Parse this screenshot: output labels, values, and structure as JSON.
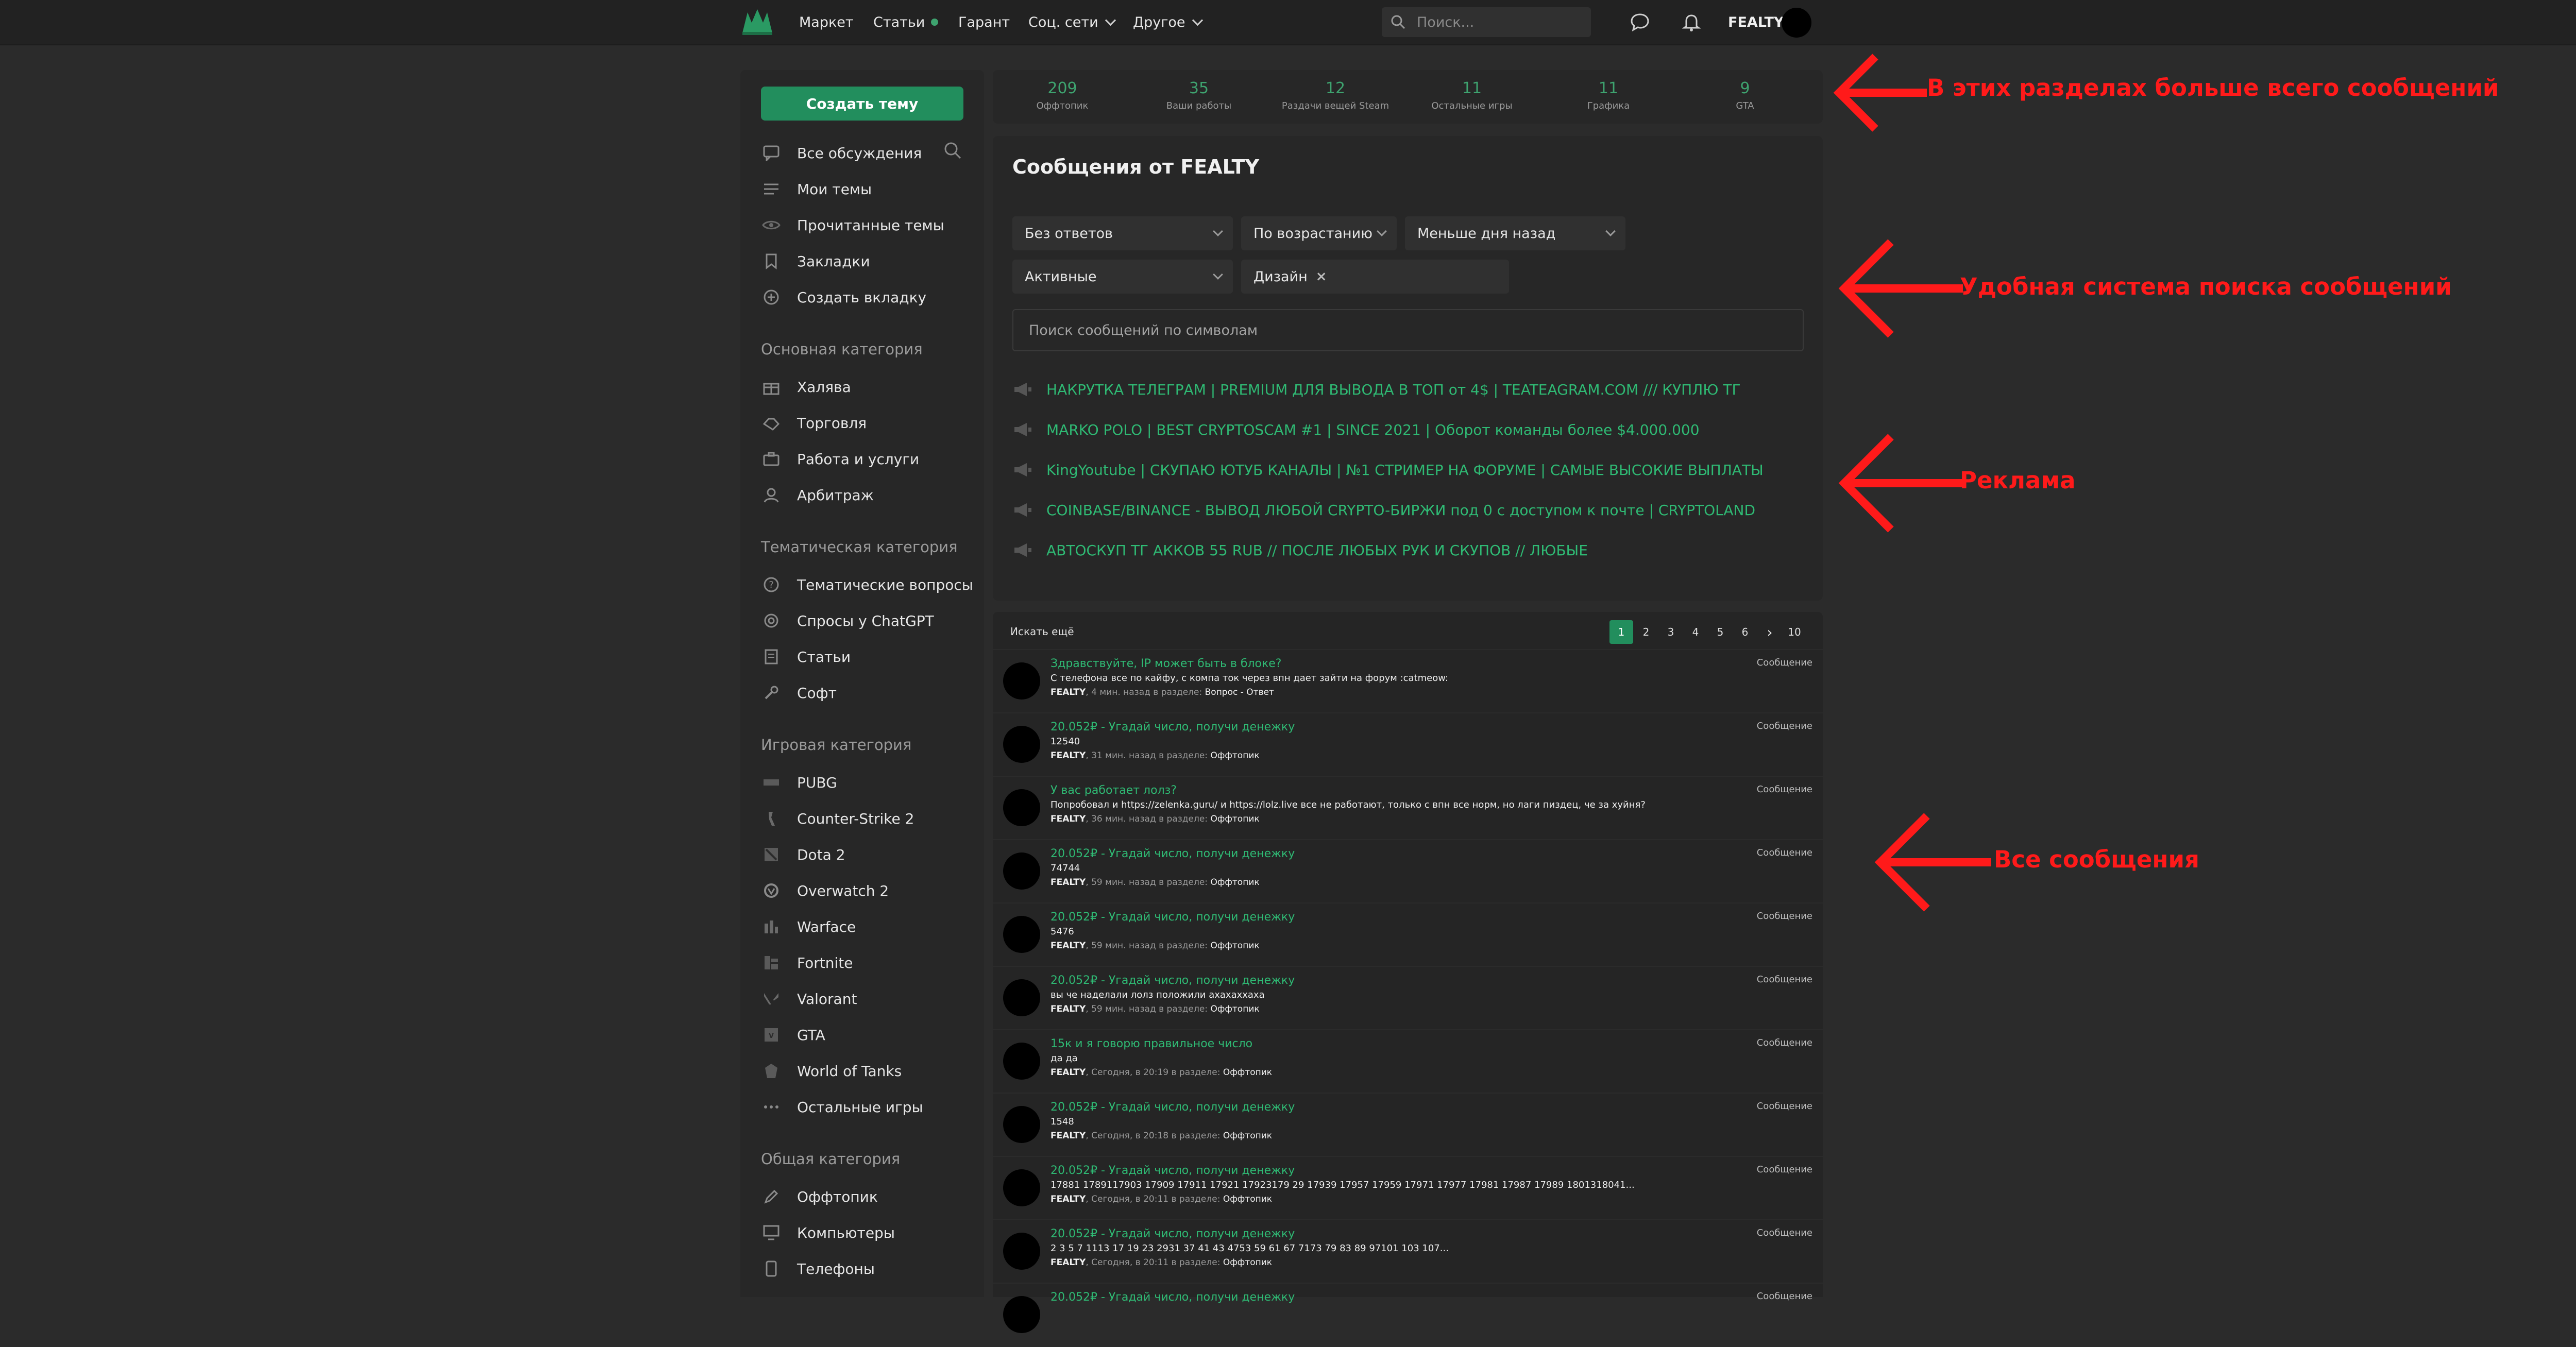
{
  "colors": {
    "accent": "#2fba74",
    "button": "#228e5d",
    "annotation": "#ff1a1a"
  },
  "topbar": {
    "logo_icon": "tree-logo-icon",
    "nav": [
      "Маркет",
      "Статьи",
      "Гарант",
      "Соц. сети",
      "Другое"
    ],
    "search_placeholder": "Поиск...",
    "username": "FEALTY",
    "icons": [
      "chat-icon",
      "bell-icon"
    ]
  },
  "sidebar": {
    "create_button": "Создать тему",
    "main_items": [
      {
        "label": "Все обсуждения",
        "icon": "discussions-icon"
      },
      {
        "label": "Мои темы",
        "icon": "list-icon"
      },
      {
        "label": "Прочитанные темы",
        "icon": "eye-icon"
      },
      {
        "label": "Закладки",
        "icon": "bookmark-icon"
      },
      {
        "label": "Создать вкладку",
        "icon": "plus-circle-icon"
      }
    ],
    "categories": [
      {
        "title": "Основная категория",
        "items": [
          "Халява",
          "Торговля",
          "Работа и услуги",
          "Арбитраж"
        ]
      },
      {
        "title": "Тематическая категория",
        "items": [
          "Тематические вопросы",
          "Спросы у ChatGPT",
          "Статьи",
          "Софт"
        ]
      },
      {
        "title": "Игровая категория",
        "items": [
          "PUBG",
          "Counter-Strike 2",
          "Dota 2",
          "Overwatch 2",
          "Warface",
          "Fortnite",
          "Valorant",
          "GTA",
          "World of Tanks",
          "Остальные игры"
        ]
      },
      {
        "title": "Общая категория",
        "items": [
          "Оффтопик",
          "Компьютеры",
          "Телефоны"
        ]
      }
    ]
  },
  "stats": [
    {
      "value": "209",
      "label": "Оффтопик"
    },
    {
      "value": "35",
      "label": "Ваши работы"
    },
    {
      "value": "12",
      "label": "Раздачи вещей Steam"
    },
    {
      "value": "11",
      "label": "Остальные игры"
    },
    {
      "value": "11",
      "label": "Графика"
    },
    {
      "value": "9",
      "label": "GTA"
    }
  ],
  "panel": {
    "title": "Сообщения от FEALTY",
    "filters": {
      "replies": "Без ответов",
      "order": "По возрастанию",
      "period": "Меньше дня назад",
      "state": "Активные",
      "tag": "Дизайн"
    },
    "search_placeholder": "Поиск сообщений по символам",
    "ads": [
      "НАКРУТКА ТЕЛЕГРАМ | PREMIUM ДЛЯ ВЫВОДА В ТОП от 4$ | TEATEAGRAM.COM /// КУПЛЮ ТГ",
      "MARKO POLO | BEST CRYPTOSCAM #1 | SINCE 2021 | Оборот команды более $4.000.000",
      "KingYoutube | СКУПАЮ ЮТУБ КАНАЛЫ | №1 СТРИМЕР НА ФОРУМЕ | САМЫЕ ВЫСОКИЕ ВЫПЛАТЫ",
      "COINBASE/BINANCE - ВЫВОД ЛЮБОЙ CRYPTO-БИРЖИ под 0 с доступом к почте | CRYPTOLAND",
      "АВТОСКУП ТГ АККОВ 55 RUB // ПОСЛЕ ЛЮБЫХ РУК И СКУПОВ // ЛЮБЫЕ"
    ]
  },
  "list": {
    "search_more": "Искать ещё",
    "pages": [
      "1",
      "2",
      "3",
      "4",
      "5",
      "6",
      "›",
      "10"
    ],
    "messages": [
      {
        "title": "Здравствуйте, IP может быть в блоке?",
        "body": "С телефона все по кайфу, с компа ток через впн дает зайти на форум :catmeow:",
        "author": "FEALTY",
        "when": ", 4 мин. назад в разделе: ",
        "section": "Вопрос - Ответ",
        "type": "Сообщение"
      },
      {
        "title": "20.052₽ - Угадай число, получи денежку",
        "body": "12540",
        "author": "FEALTY",
        "when": ", 31 мин. назад в разделе: ",
        "section": "Оффтопик",
        "type": "Сообщение"
      },
      {
        "title": "У вас работает лолз?",
        "body": "Попробовал и https://zelenka.guru/ и https://lolz.live все не работают, только с впн все норм, но лаги пиздец, че за хуйня?",
        "author": "FEALTY",
        "when": ", 36 мин. назад в разделе: ",
        "section": "Оффтопик",
        "type": "Сообщение"
      },
      {
        "title": "20.052₽ - Угадай число, получи денежку",
        "body": "74744",
        "author": "FEALTY",
        "when": ", 59 мин. назад в разделе: ",
        "section": "Оффтопик",
        "type": "Сообщение"
      },
      {
        "title": "20.052₽ - Угадай число, получи денежку",
        "body": "5476",
        "author": "FEALTY",
        "when": ", 59 мин. назад в разделе: ",
        "section": "Оффтопик",
        "type": "Сообщение"
      },
      {
        "title": "20.052₽ - Угадай число, получи денежку",
        "body": "вы че наделали лолз положили ахахаххаха",
        "author": "FEALTY",
        "when": ", 59 мин. назад в разделе: ",
        "section": "Оффтопик",
        "type": "Сообщение"
      },
      {
        "title": "15к и я говорю правильное число",
        "body": "да да",
        "author": "FEALTY",
        "when": ", Сегодня, в 20:19 в разделе: ",
        "section": "Оффтопик",
        "type": "Сообщение"
      },
      {
        "title": "20.052₽ - Угадай число, получи денежку",
        "body": "1548",
        "author": "FEALTY",
        "when": ", Сегодня, в 20:18 в разделе: ",
        "section": "Оффтопик",
        "type": "Сообщение"
      },
      {
        "title": "20.052₽ - Угадай число, получи денежку",
        "body": "17881 1789117903 17909 17911 17921 17923179 29 17939 17957 17959 17971 17977 17981 17987 17989 1801318041...",
        "author": "FEALTY",
        "when": ", Сегодня, в 20:11 в разделе: ",
        "section": "Оффтопик",
        "type": "Сообщение"
      },
      {
        "title": "20.052₽ - Угадай число, получи денежку",
        "body": "2 3 5 7 1113 17 19 23 2931 37 41 43 4753 59 61 67 7173 79 83 89 97101 103 107...",
        "author": "FEALTY",
        "when": ", Сегодня, в 20:11 в разделе: ",
        "section": "Оффтопик",
        "type": "Сообщение"
      },
      {
        "title": "20.052₽ - Угадай число, получи денежку",
        "body": "",
        "author": "",
        "when": "",
        "section": "",
        "type": "Сообщение"
      }
    ]
  },
  "annotations": [
    "В этих разделах больше всего сообщений",
    "Удобная система поиска сообщений",
    "Реклама",
    "Все сообщения"
  ]
}
